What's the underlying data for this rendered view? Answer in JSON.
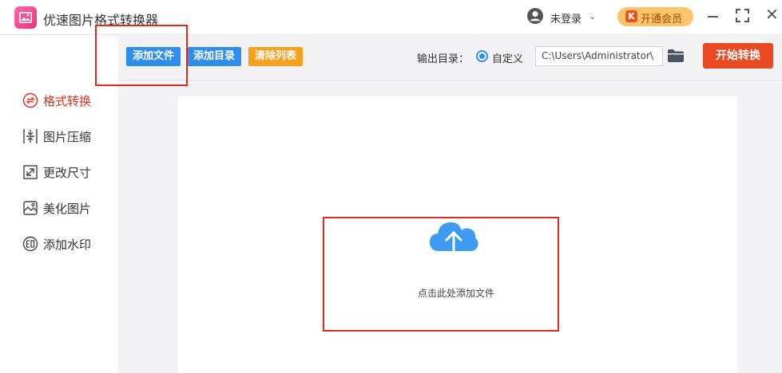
{
  "app": {
    "title": "优速图片格式转换器"
  },
  "account": {
    "label": "未登录",
    "chevron": "⌄"
  },
  "vip": {
    "icon": "K",
    "label": "开通会员"
  },
  "sidebar": {
    "items": [
      {
        "label": "格式转换",
        "icon": "format-convert-icon",
        "active": true
      },
      {
        "label": "图片压缩",
        "icon": "compress-icon"
      },
      {
        "label": "更改尺寸",
        "icon": "resize-icon"
      },
      {
        "label": "美化图片",
        "icon": "beautify-icon"
      },
      {
        "label": "添加水印",
        "icon": "watermark-icon"
      }
    ]
  },
  "toolbar": {
    "add_file": "添加文件",
    "add_dir": "添加目录",
    "clear_list": "清除列表",
    "output_label": "输出目录：",
    "radio_label": "自定义",
    "output_path": "C:\\Users\\Administrator\\",
    "start": "开始转换"
  },
  "dropzone": {
    "label": "点击此处添加文件",
    "icon": "cloud-upload-icon"
  },
  "colors": {
    "primary": "#2e8ef0",
    "warning": "#f7a21c",
    "danger": "#ea4a22",
    "active_nav": "#d8301f",
    "annotation": "#e02a20"
  }
}
